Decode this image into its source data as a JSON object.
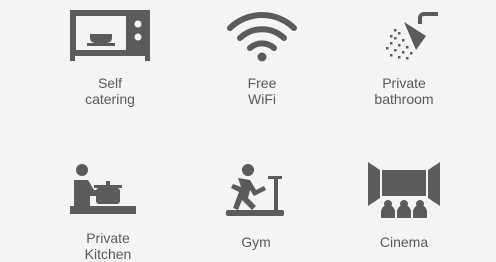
{
  "amenities": [
    {
      "icon": "microwave-icon",
      "line1": "Self",
      "line2": "catering"
    },
    {
      "icon": "wifi-icon",
      "line1": "Free",
      "line2": "WiFi"
    },
    {
      "icon": "shower-icon",
      "line1": "Private",
      "line2": "bathroom"
    },
    {
      "icon": "kitchen-cook-icon",
      "line1": "Private",
      "line2": "Kitchen"
    },
    {
      "icon": "treadmill-icon",
      "line1": "Gym",
      "line2": ""
    },
    {
      "icon": "cinema-icon",
      "line1": "Cinema",
      "line2": ""
    }
  ],
  "colors": {
    "background": "#f4f4f4",
    "icon": "#5b5b5b",
    "text": "#5a5a5a"
  }
}
